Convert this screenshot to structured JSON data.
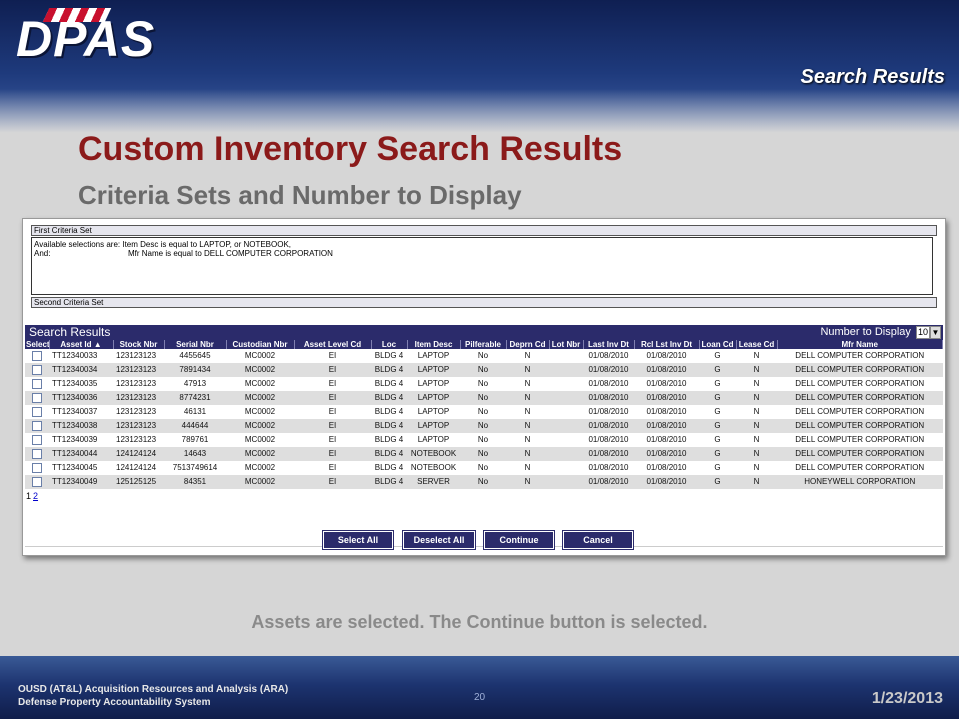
{
  "slide": {
    "logo": "DPAS",
    "section": "Search Results",
    "title": "Custom Inventory Search Results",
    "subtitle": "Criteria Sets and Number to Display",
    "caption": "Assets are selected.  The Continue button is selected.",
    "footer_line1": "OUSD (AT&L) Acquisition Resources and Analysis (ARA)",
    "footer_line2": "Defense Property Accountability System",
    "page_number": "20",
    "date": "1/23/2013"
  },
  "criteria": {
    "first_label": "First Criteria Set",
    "line1_label": "Available selections are:",
    "line1_text": "Item Desc is equal to LAPTOP, or NOTEBOOK,",
    "line2_label": "And:",
    "line2_text": "Mfr Name is equal to DELL COMPUTER CORPORATION",
    "second_label": "Second Criteria Set"
  },
  "results": {
    "title": "Search Results",
    "number_to_display_label": "Number to Display",
    "number_to_display_value": "10",
    "columns": [
      "Select",
      "Asset Id ▲",
      "Stock Nbr",
      "Serial Nbr",
      "Custodian Nbr",
      "Asset Level Cd",
      "Loc",
      "Item Desc",
      "Pilferable",
      "Deprn Cd",
      "Lot Nbr",
      "Last Inv Dt",
      "Rcl Lst Inv Dt",
      "Loan Cd",
      "Lease Cd",
      "Mfr Name"
    ],
    "rows": [
      [
        "TT12340033",
        "123123123",
        "4455645",
        "MC0002",
        "EI",
        "BLDG 4",
        "LAPTOP",
        "No",
        "N",
        "",
        "01/08/2010",
        "01/08/2010",
        "G",
        "N",
        "DELL COMPUTER CORPORATION"
      ],
      [
        "TT12340034",
        "123123123",
        "7891434",
        "MC0002",
        "EI",
        "BLDG 4",
        "LAPTOP",
        "No",
        "N",
        "",
        "01/08/2010",
        "01/08/2010",
        "G",
        "N",
        "DELL COMPUTER CORPORATION"
      ],
      [
        "TT12340035",
        "123123123",
        "47913",
        "MC0002",
        "EI",
        "BLDG 4",
        "LAPTOP",
        "No",
        "N",
        "",
        "01/08/2010",
        "01/08/2010",
        "G",
        "N",
        "DELL COMPUTER CORPORATION"
      ],
      [
        "TT12340036",
        "123123123",
        "8774231",
        "MC0002",
        "EI",
        "BLDG 4",
        "LAPTOP",
        "No",
        "N",
        "",
        "01/08/2010",
        "01/08/2010",
        "G",
        "N",
        "DELL COMPUTER CORPORATION"
      ],
      [
        "TT12340037",
        "123123123",
        "46131",
        "MC0002",
        "EI",
        "BLDG 4",
        "LAPTOP",
        "No",
        "N",
        "",
        "01/08/2010",
        "01/08/2010",
        "G",
        "N",
        "DELL COMPUTER CORPORATION"
      ],
      [
        "TT12340038",
        "123123123",
        "444644",
        "MC0002",
        "EI",
        "BLDG 4",
        "LAPTOP",
        "No",
        "N",
        "",
        "01/08/2010",
        "01/08/2010",
        "G",
        "N",
        "DELL COMPUTER CORPORATION"
      ],
      [
        "TT12340039",
        "123123123",
        "789761",
        "MC0002",
        "EI",
        "BLDG 4",
        "LAPTOP",
        "No",
        "N",
        "",
        "01/08/2010",
        "01/08/2010",
        "G",
        "N",
        "DELL COMPUTER CORPORATION"
      ],
      [
        "TT12340044",
        "124124124",
        "14643",
        "MC0002",
        "EI",
        "BLDG 4",
        "NOTEBOOK",
        "No",
        "N",
        "",
        "01/08/2010",
        "01/08/2010",
        "G",
        "N",
        "DELL COMPUTER CORPORATION"
      ],
      [
        "TT12340045",
        "124124124",
        "7513749614",
        "MC0002",
        "EI",
        "BLDG 4",
        "NOTEBOOK",
        "No",
        "N",
        "",
        "01/08/2010",
        "01/08/2010",
        "G",
        "N",
        "DELL COMPUTER CORPORATION"
      ],
      [
        "TT12340049",
        "125125125",
        "84351",
        "MC0002",
        "EI",
        "BLDG 4",
        "SERVER",
        "No",
        "N",
        "",
        "01/08/2010",
        "01/08/2010",
        "G",
        "N",
        "HONEYWELL CORPORATION"
      ]
    ],
    "pager_current": "1",
    "pager_next": "2"
  },
  "buttons": {
    "select_all": "Select All",
    "deselect_all": "Deselect All",
    "continue": "Continue",
    "cancel": "Cancel"
  },
  "colors": {
    "header_navy": "#2b2b6b",
    "title_red": "#8b1a1a"
  }
}
